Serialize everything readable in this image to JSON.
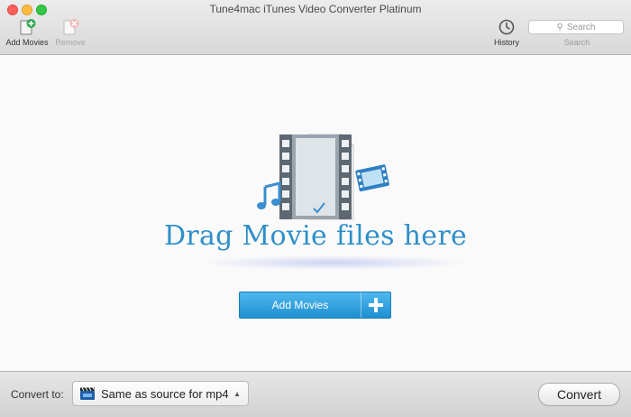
{
  "window": {
    "title": "Tune4mac iTunes Video Converter Platinum"
  },
  "toolbar": {
    "add_movies_label": "Add Movies",
    "remove_label": "Remove",
    "history_label": "History",
    "search_placeholder": "Search",
    "search_caption": "Search"
  },
  "main": {
    "drag_text": "Drag Movie files here",
    "add_movies_button": "Add Movies"
  },
  "bottom": {
    "convert_to_label": "Convert to:",
    "format_value": "Same as source for mp4",
    "convert_button": "Convert"
  },
  "colors": {
    "accent": "#2f8fc9",
    "button_blue": "#1f8fd1"
  }
}
